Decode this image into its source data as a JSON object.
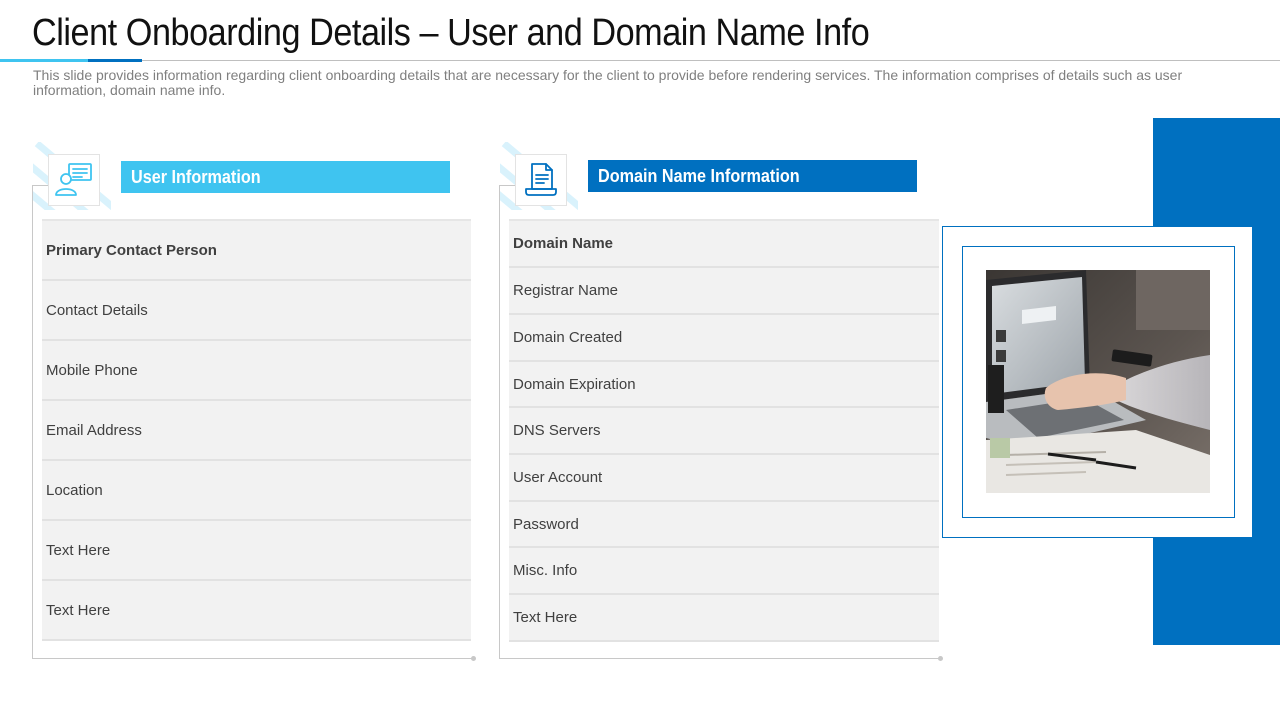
{
  "page": {
    "title": "Client Onboarding Details – User and Domain Name Info",
    "subtitle": "This slide provides information regarding client onboarding details that are necessary for the client to provide before rendering services. The information comprises of details such as user information, domain name info."
  },
  "colors": {
    "accent_light": "#3fc4f0",
    "accent_dark": "#0070c0",
    "row_fill": "#f2f2f2"
  },
  "user_info": {
    "header": "User Information",
    "icon": "user-document-icon",
    "rows": [
      "Primary Contact Person",
      "Contact Details",
      "Mobile  Phone",
      "Email Address",
      "Location",
      "Text Here",
      "Text Here"
    ]
  },
  "domain_info": {
    "header": "Domain Name Information",
    "icon": "document-laptop-icon",
    "rows": [
      "Domain Name",
      "Registrar Name",
      "Domain Created",
      "Domain Expiration",
      "DNS Servers",
      "User Account",
      "Password",
      "Misc. Info",
      "Text Here"
    ]
  },
  "photo": {
    "subject": "person typing on laptop"
  }
}
